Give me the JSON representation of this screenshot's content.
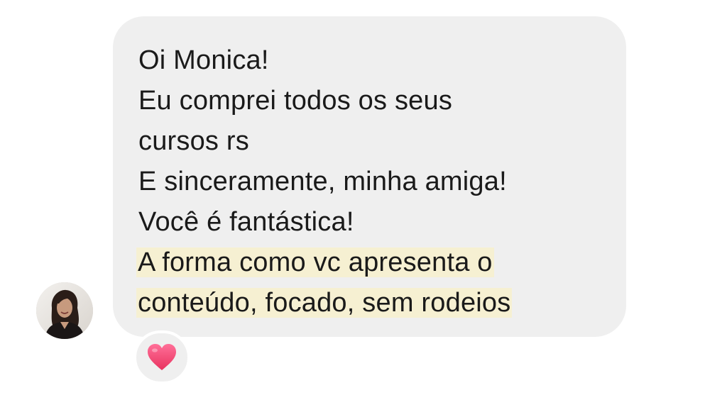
{
  "message": {
    "lines": [
      "Oi Monica!",
      "Eu comprei todos os seus",
      "cursos rs",
      "E sinceramente, minha amiga!",
      "Você é fantástica!",
      "A forma como vc apresenta o",
      "conteúdo, focado, sem rodeios"
    ],
    "highlighted_lines": [
      5,
      6
    ],
    "highlight_color": "#f6f0d2",
    "bubble_color": "#efefef"
  },
  "sender": {
    "avatar_icon": "profile-photo"
  },
  "reaction": {
    "icon": "heart-icon",
    "color": "#f0457a"
  }
}
